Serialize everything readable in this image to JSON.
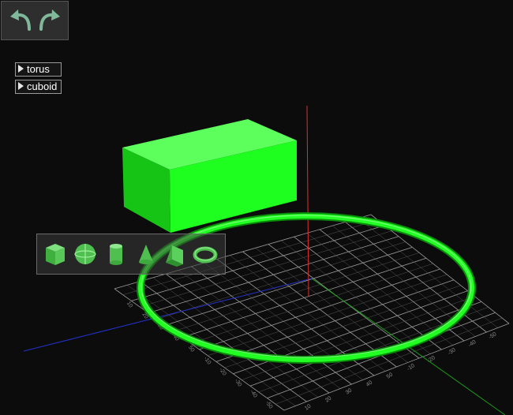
{
  "toolbar": {
    "undo_icon": "curved-arrow-left-icon",
    "redo_icon": "curved-arrow-right-icon"
  },
  "objects": [
    {
      "label": "torus"
    },
    {
      "label": "cuboid"
    }
  ],
  "shapes": [
    {
      "icon": "cube-icon"
    },
    {
      "icon": "sphere-icon"
    },
    {
      "icon": "cylinder-icon"
    },
    {
      "icon": "cone-icon"
    },
    {
      "icon": "wedge-icon"
    },
    {
      "icon": "torus-icon"
    }
  ],
  "grid": {
    "tick_labels": [
      "10",
      "20",
      "30",
      "40",
      "50",
      "-10",
      "-20",
      "-30",
      "-40",
      "-50"
    ]
  },
  "colors": {
    "background": "#0c0c0c",
    "object": "#22ff22",
    "grid": "#8a8a8a",
    "axis_z": "#ff3030",
    "axis_x": "#3050ff",
    "axis_y": "#20c020"
  }
}
